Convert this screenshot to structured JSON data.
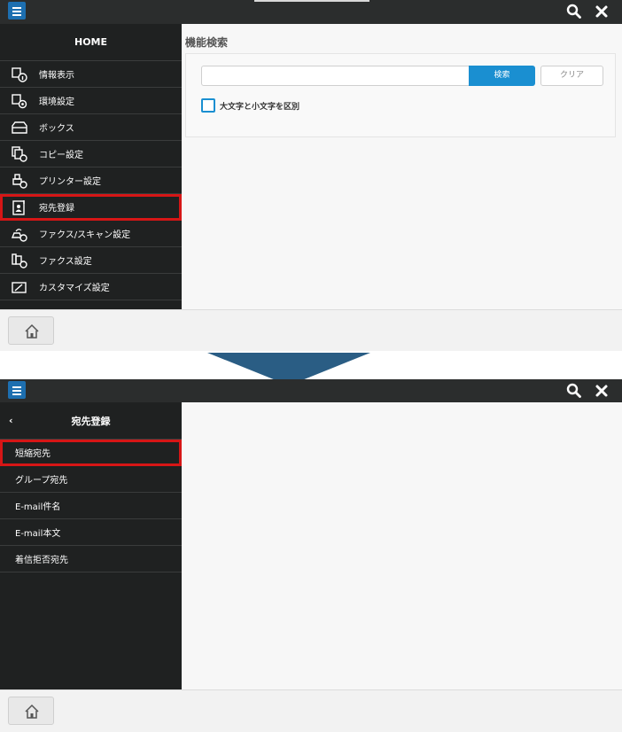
{
  "screen1": {
    "sidebar": {
      "title": "HOME",
      "items": [
        {
          "label": "情報表示",
          "icon": "info-display-icon"
        },
        {
          "label": "環境設定",
          "icon": "environment-settings-icon"
        },
        {
          "label": "ボックス",
          "icon": "box-icon"
        },
        {
          "label": "コピー設定",
          "icon": "copy-settings-icon"
        },
        {
          "label": "プリンター設定",
          "icon": "printer-settings-icon"
        },
        {
          "label": "宛先登録",
          "icon": "address-register-icon",
          "highlighted": true
        },
        {
          "label": "ファクス/スキャン設定",
          "icon": "fax-scan-settings-icon"
        },
        {
          "label": "ファクス設定",
          "icon": "fax-settings-icon"
        },
        {
          "label": "カスタマイズ設定",
          "icon": "customize-settings-icon"
        }
      ]
    },
    "main": {
      "title": "機能検索",
      "search_value": "",
      "search_button": "検索",
      "clear_button": "クリア",
      "case_checkbox_label": "大文字と小文字を区別",
      "case_checkbox_checked": false
    }
  },
  "screen2": {
    "sidebar": {
      "back": "‹",
      "title": "宛先登録",
      "items": [
        {
          "label": "短縮宛先",
          "highlighted": true
        },
        {
          "label": "グループ宛先"
        },
        {
          "label": "E-mail件名"
        },
        {
          "label": "E-mail本文"
        },
        {
          "label": "着信拒否宛先"
        }
      ]
    }
  },
  "colors": {
    "topbar": "#2b2d2d",
    "sidebar": "#1f2121",
    "accent": "#1a8fd1",
    "highlight": "#d61616",
    "arrow": "#2a5d84"
  }
}
